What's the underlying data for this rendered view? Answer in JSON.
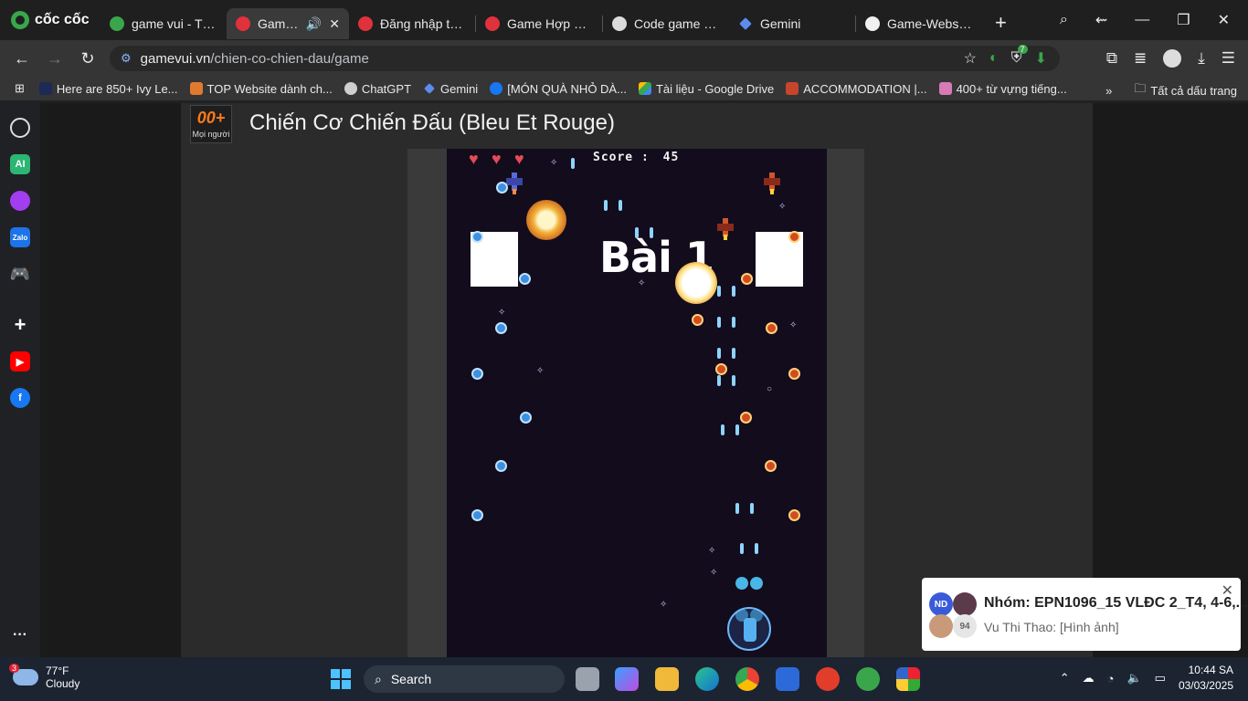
{
  "browser": {
    "brand": "cốc cốc",
    "tabs": [
      {
        "title": "game vui - Tìm v",
        "active": false
      },
      {
        "title": "Game C",
        "active": true
      },
      {
        "title": "Đăng nhập tài kh",
        "active": false
      },
      {
        "title": "Game Hợp nhất",
        "active": false
      },
      {
        "title": "Code game tươn",
        "active": false
      },
      {
        "title": "Gemini",
        "active": false
      },
      {
        "title": "Game-Website/F",
        "active": false
      }
    ],
    "url_host": "gamevui.vn",
    "url_path": "/chien-co-chien-dau/game",
    "extension_badge": "7",
    "bookmarks": [
      "Here are 850+ Ivy Le...",
      "TOP Website dành ch...",
      "ChatGPT",
      "Gemini",
      "[MÓN QUÀ NHỎ DÀ...",
      "Tài liệu - Google Drive",
      "ACCOMMODATION |...",
      "400+ từ vựng tiếng..."
    ],
    "all_bookmarks": "Tất cả dấu trang"
  },
  "site": {
    "logo_big": "00+",
    "logo_small": "Mọi người",
    "title": "Chiến Cơ Chiến Đấu (Bleu Et Rouge)"
  },
  "game": {
    "score_label": "Score :",
    "score": "45",
    "lives": 3,
    "level_text": "Bài 1"
  },
  "notification": {
    "avatar_initials": "ND",
    "member_count": "94",
    "title": "Nhóm: EPN1096_15 VLĐC 2_T4, 4-6,...",
    "message": "Vu Thi Thao: [Hình ảnh]"
  },
  "taskbar": {
    "weather_badge": "3",
    "temperature": "77°F",
    "condition": "Cloudy",
    "search_placeholder": "Search",
    "time": "10:44 SA",
    "date": "03/03/2025"
  },
  "colors": {
    "accent_green": "#3aa64b",
    "game_bg": "#120c1c",
    "heart": "#e54a55"
  }
}
